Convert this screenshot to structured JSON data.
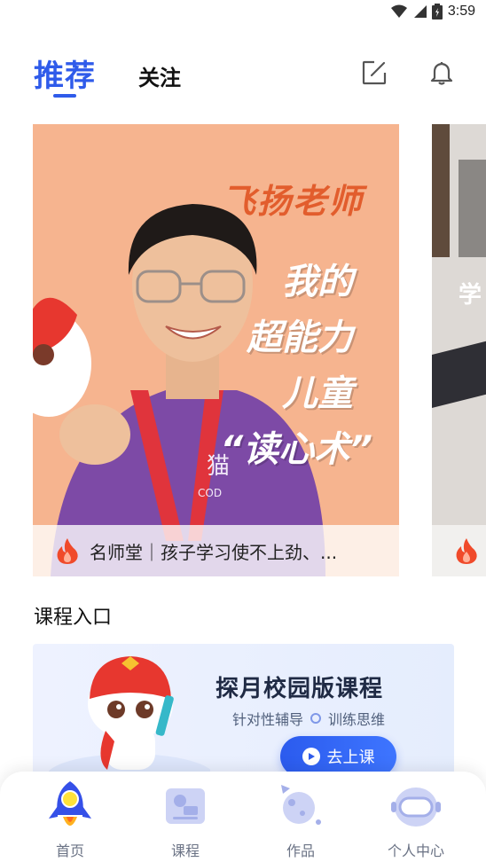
{
  "status_bar": {
    "time": "3:59"
  },
  "header": {
    "tab_recommend": "推荐",
    "tab_follow": "关注"
  },
  "carousel": {
    "main_card": {
      "poster_teacher": "飞扬老师",
      "poster_line1": "我的",
      "poster_line2": "超能力",
      "poster_line3": "儿童",
      "poster_line4": "“读心术”",
      "caption": "名师堂｜孩子学习使不上劲、..."
    },
    "peek_card": {
      "poster_text": "学"
    }
  },
  "section": {
    "course_entry_title": "课程入口"
  },
  "course_card": {
    "title": "探月校园版课程",
    "sub_left": "针对性辅导",
    "sub_right": "训练思维",
    "button_label": "去上课"
  },
  "bottom_nav": {
    "items": [
      {
        "label": "首页",
        "icon": "rocket-icon"
      },
      {
        "label": "课程",
        "icon": "course-book-icon"
      },
      {
        "label": "作品",
        "icon": "planet-icon"
      },
      {
        "label": "个人中心",
        "icon": "astronaut-helmet-icon"
      }
    ]
  },
  "colors": {
    "accent": "#2f5bea",
    "poster_bg": "#f6b48f",
    "fire": "#f04a2a"
  }
}
